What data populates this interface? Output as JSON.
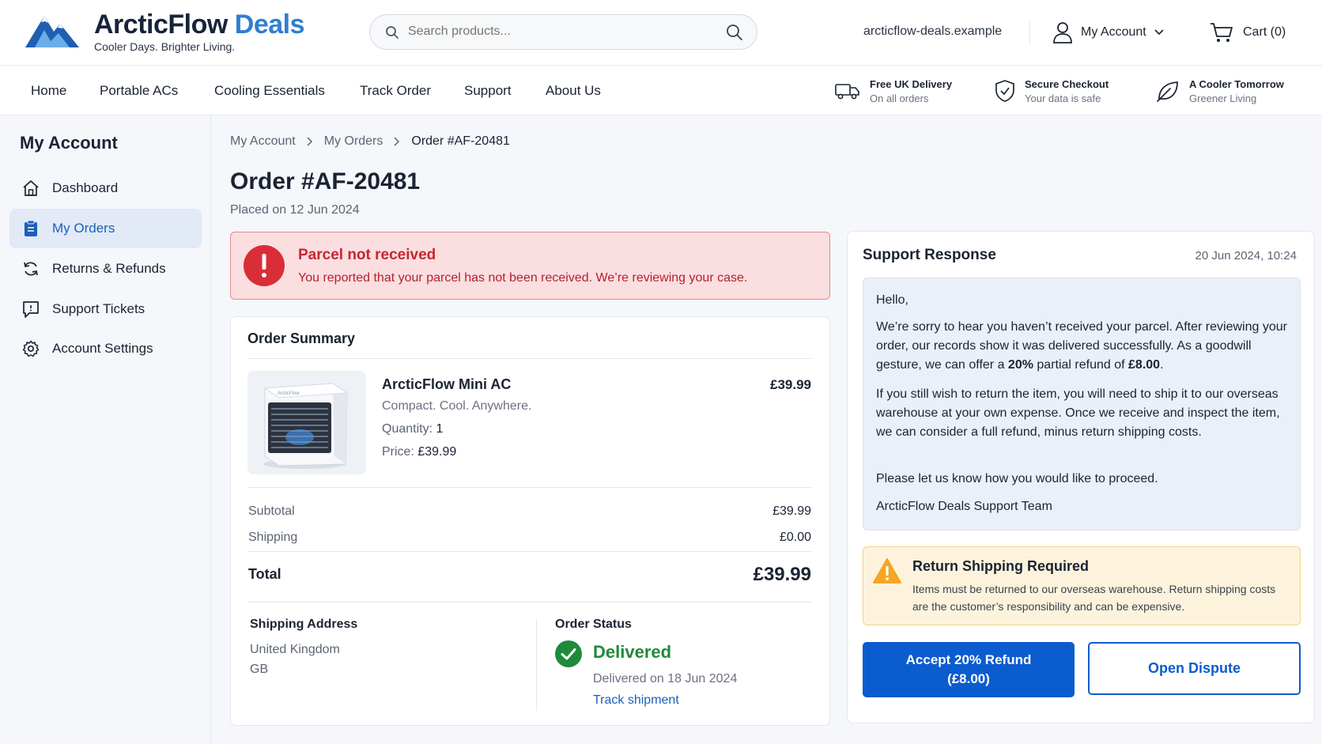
{
  "brand": {
    "name_part1": "ArcticFlow",
    "name_part2": "Deals",
    "tagline": "Cooler Days. Brighter Living."
  },
  "search": {
    "placeholder": "Search products..."
  },
  "header": {
    "domain": "arcticflow-deals.example",
    "account_label": "My Account",
    "cart_label": "Cart (0)"
  },
  "nav": {
    "items": [
      "Home",
      "Portable ACs",
      "Cooling Essentials",
      "Track Order",
      "Support",
      "About Us"
    ]
  },
  "features": [
    {
      "icon": "truck-icon",
      "title": "Free UK Delivery",
      "subtitle": "On all orders"
    },
    {
      "icon": "shield-icon",
      "title": "Secure Checkout",
      "subtitle": "Your data is safe"
    },
    {
      "icon": "leaf-icon",
      "title": "A Cooler Tomorrow",
      "subtitle": "Greener Living"
    }
  ],
  "sidebar": {
    "title": "My Account",
    "items": [
      {
        "label": "Dashboard",
        "icon": "home-icon"
      },
      {
        "label": "My Orders",
        "icon": "clipboard-icon",
        "active": true
      },
      {
        "label": "Returns & Refunds",
        "icon": "refresh-icon"
      },
      {
        "label": "Support Tickets",
        "icon": "ticket-icon"
      },
      {
        "label": "Account Settings",
        "icon": "gear-icon"
      }
    ]
  },
  "breadcrumb": [
    "My Account",
    "My Orders",
    "Order #AF-20481"
  ],
  "order": {
    "title": "Order #AF-20481",
    "placed": "Placed on 12 Jun 2024"
  },
  "alert": {
    "title": "Parcel not received",
    "text": "You reported that your parcel has not been received. We’re reviewing your case."
  },
  "summary": {
    "title": "Order Summary",
    "product": {
      "name": "ArcticFlow Mini AC",
      "tagline": "Compact. Cool. Anywhere.",
      "qty_label": "Quantity:",
      "qty": "1",
      "price_label": "Price:",
      "price": "£39.99",
      "amount": "£39.99",
      "image_brand": "ArcticFlow"
    },
    "subtotal_label": "Subtotal",
    "subtotal": "£39.99",
    "shipping_label": "Shipping",
    "shipping": "£0.00",
    "total_label": "Total",
    "total": "£39.99",
    "ship_address_title": "Shipping Address",
    "ship_address": [
      "United Kingdom",
      "GB"
    ],
    "status_title": "Order Status",
    "status": "Delivered",
    "status_date": "Delivered on 18 Jun 2024",
    "track_label": "Track shipment"
  },
  "support": {
    "title": "Support Response",
    "date": "20 Jun 2024, 10:24",
    "greeting": "Hello,",
    "p1_pre": "We’re sorry to hear you haven’t received your parcel. After reviewing your order, our records show it was delivered successfully. As a goodwill gesture, we can offer a ",
    "p1_pct": "20%",
    "p1_mid": " partial refund of ",
    "p1_amount": "£8.00",
    "p1_end": ".",
    "p2": "If you still wish to return the item, you will need to ship it to our overseas warehouse at your own expense. Once we receive and inspect the item, we can consider a full refund, minus return shipping costs.",
    "p3": "Please let us know how you would like to proceed.",
    "signoff": "ArcticFlow Deals Support Team"
  },
  "warning": {
    "title": "Return Shipping Required",
    "text": "Items must be returned to our overseas warehouse. Return shipping costs are the customer’s responsibility and can be expensive."
  },
  "actions": {
    "accept_line1": "Accept 20% Refund",
    "accept_line2": "(£8.00)",
    "dispute": "Open Dispute"
  },
  "colors": {
    "primary": "#0b5ccf",
    "success": "#1f8a3a",
    "danger": "#c62631",
    "warning": "#f5a623",
    "brand_accent": "#2f7fd0"
  }
}
